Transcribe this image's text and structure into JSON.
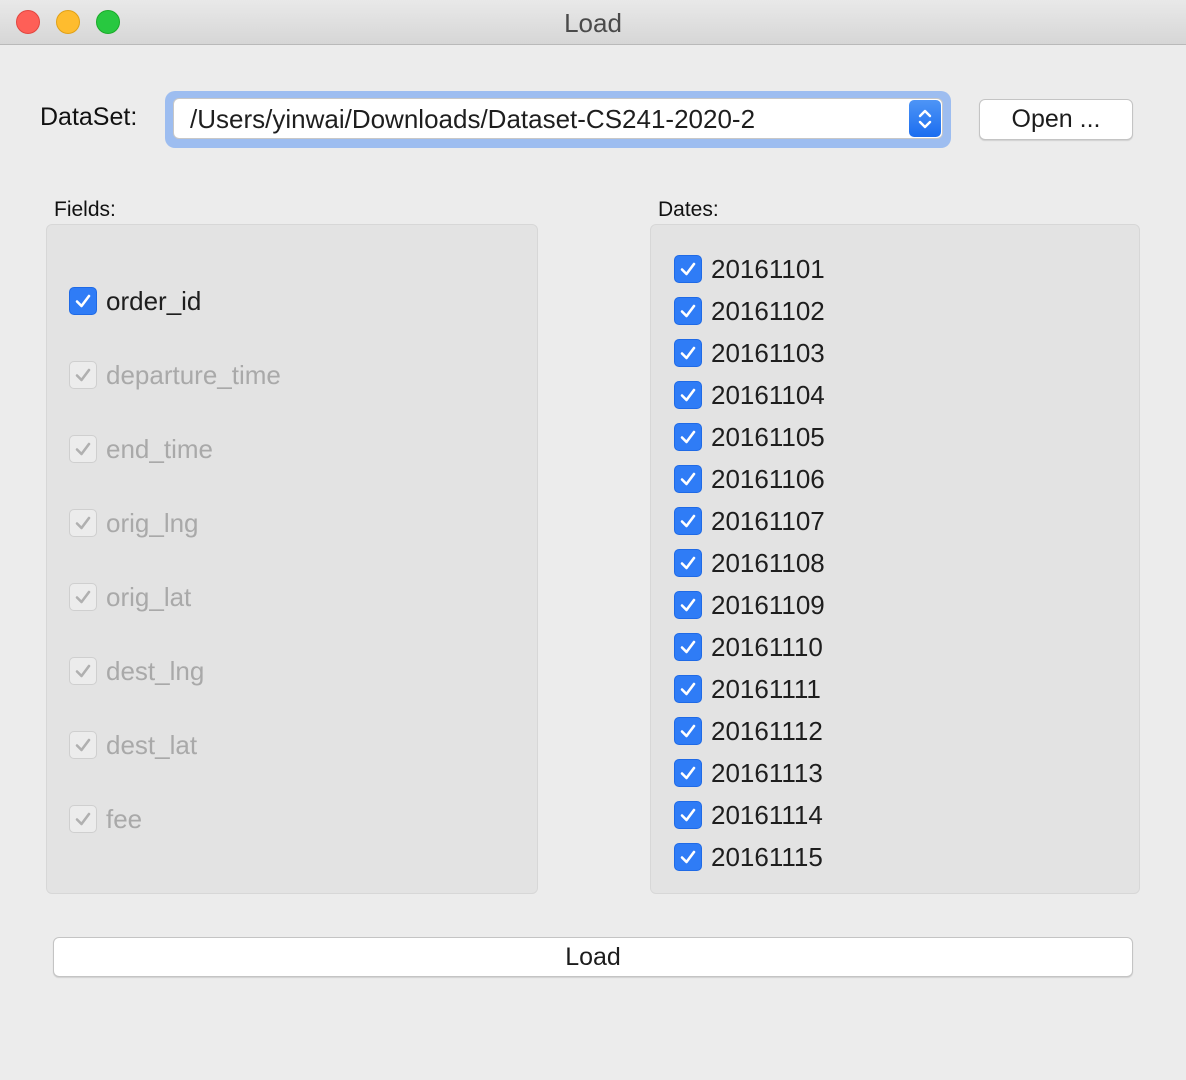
{
  "window": {
    "title": "Load"
  },
  "dataset": {
    "label": "DataSet:",
    "path": "/Users/yinwai/Downloads/Dataset-CS241-2020-2",
    "open_button": "Open ..."
  },
  "fields": {
    "label": "Fields:",
    "items": [
      {
        "label": "order_id",
        "checked": true,
        "enabled": true
      },
      {
        "label": "departure_time",
        "checked": true,
        "enabled": false
      },
      {
        "label": "end_time",
        "checked": true,
        "enabled": false
      },
      {
        "label": "orig_lng",
        "checked": true,
        "enabled": false
      },
      {
        "label": "orig_lat",
        "checked": true,
        "enabled": false
      },
      {
        "label": "dest_lng",
        "checked": true,
        "enabled": false
      },
      {
        "label": "dest_lat",
        "checked": true,
        "enabled": false
      },
      {
        "label": "fee",
        "checked": true,
        "enabled": false
      }
    ]
  },
  "dates": {
    "label": "Dates:",
    "items": [
      {
        "label": "20161101",
        "checked": true
      },
      {
        "label": "20161102",
        "checked": true
      },
      {
        "label": "20161103",
        "checked": true
      },
      {
        "label": "20161104",
        "checked": true
      },
      {
        "label": "20161105",
        "checked": true
      },
      {
        "label": "20161106",
        "checked": true
      },
      {
        "label": "20161107",
        "checked": true
      },
      {
        "label": "20161108",
        "checked": true
      },
      {
        "label": "20161109",
        "checked": true
      },
      {
        "label": "20161110",
        "checked": true
      },
      {
        "label": "20161111",
        "checked": true
      },
      {
        "label": "20161112",
        "checked": true
      },
      {
        "label": "20161113",
        "checked": true
      },
      {
        "label": "20161114",
        "checked": true
      },
      {
        "label": "20161115",
        "checked": true
      }
    ]
  },
  "load_button": "Load",
  "colors": {
    "accent": "#2f7cf6",
    "focus_ring": "#9dbdf0",
    "background": "#ececec"
  }
}
